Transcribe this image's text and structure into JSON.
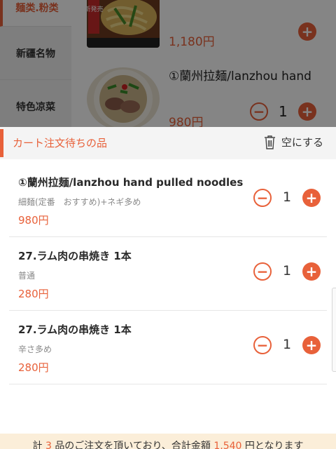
{
  "background_menu": {
    "categories": [
      {
        "label": "麺类.粉类",
        "active": true
      },
      {
        "label": "新疆名物",
        "active": false
      },
      {
        "label": "特色凉菜",
        "active": false
      }
    ],
    "items": [
      {
        "image_label": "新発売",
        "price": "1,180円"
      },
      {
        "name": "①蘭州拉麺/lanzhou hand",
        "price": "980円",
        "quantity": "1"
      }
    ]
  },
  "cart": {
    "title": "カート注文待ちの品",
    "clear_label": "空にする",
    "items": [
      {
        "name": "①蘭州拉麺/lanzhou hand pulled noodles",
        "option": "細麺(定番　おすすめ)+ネギ多め",
        "price": "980円",
        "quantity": "1"
      },
      {
        "name": "27.ラム肉の串焼き 1本",
        "option": "普通",
        "price": "280円",
        "quantity": "1"
      },
      {
        "name": "27.ラム肉の串焼き 1本",
        "option": "辛さ多め",
        "price": "280円",
        "quantity": "1"
      }
    ]
  },
  "footer": {
    "prefix": "計",
    "count": "3",
    "middle": "品のご注文を頂いており、合計金額",
    "total": "1,540",
    "suffix": "円となります"
  },
  "colors": {
    "accent": "#e8613a",
    "footer_bg": "#fbeed9"
  },
  "icons": {
    "clear": "trash-icon",
    "add": "plus-icon",
    "remove": "minus-icon"
  }
}
